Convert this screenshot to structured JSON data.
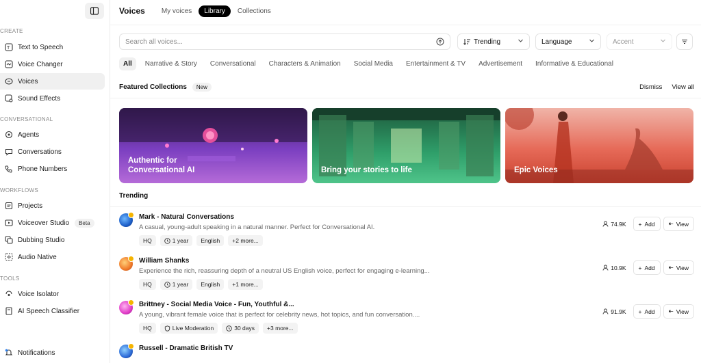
{
  "sidebar": {
    "sections": {
      "create": "CREATE",
      "conversational": "CONVERSATIONAL",
      "workflows": "WORKFLOWS",
      "tools": "TOOLS"
    },
    "items": {
      "text_to_speech": "Text to Speech",
      "voice_changer": "Voice Changer",
      "voices": "Voices",
      "sound_effects": "Sound Effects",
      "agents": "Agents",
      "conversations": "Conversations",
      "phone_numbers": "Phone Numbers",
      "projects": "Projects",
      "voiceover_studio": "Voiceover Studio",
      "dubbing_studio": "Dubbing Studio",
      "audio_native": "Audio Native",
      "voice_isolator": "Voice Isolator",
      "ai_speech_classifier": "AI Speech Classifier",
      "notifications": "Notifications"
    },
    "beta_badge": "Beta"
  },
  "header": {
    "title": "Voices",
    "tabs": [
      "My voices",
      "Library",
      "Collections"
    ],
    "active_tab": "Library"
  },
  "search": {
    "placeholder": "Search all voices...",
    "value": ""
  },
  "filters": {
    "sort": "Trending",
    "language": "Language",
    "accent": "Accent"
  },
  "categories": [
    "All",
    "Narrative & Story",
    "Conversational",
    "Characters & Animation",
    "Social Media",
    "Entertainment & TV",
    "Advertisement",
    "Informative & Educational"
  ],
  "featured": {
    "title": "Featured Collections",
    "badge": "New",
    "dismiss": "Dismiss",
    "view_all": "View all",
    "cards": [
      {
        "title": "Authentic for Conversational AI"
      },
      {
        "title": "Bring your stories to life"
      },
      {
        "title": "Epic Voices"
      }
    ]
  },
  "trending": {
    "title": "Trending",
    "add_label": "Add",
    "view_label": "View",
    "voices": [
      {
        "name": "Mark - Natural Conversations",
        "description": "A casual, young-adult speaking in a natural manner. Perfect for Conversational AI.",
        "tags": [
          "HQ",
          "1 year",
          "English",
          "+2 more..."
        ],
        "uses": "74.9K"
      },
      {
        "name": "William Shanks",
        "description": "Experience the rich, reassuring depth of a neutral US English voice, perfect for engaging e-learning...",
        "tags": [
          "HQ",
          "1 year",
          "English",
          "+1 more..."
        ],
        "uses": "10.9K"
      },
      {
        "name": "Brittney - Social Media Voice - Fun, Youthful &...",
        "description": "A young, vibrant female voice that is perfect for celebrity news, hot topics, and fun conversation....",
        "tags": [
          "HQ",
          "Live Moderation",
          "30 days",
          "+3 more..."
        ],
        "uses": "91.9K"
      },
      {
        "name": "Russell - Dramatic British TV",
        "description": "",
        "tags": [],
        "uses": ""
      }
    ]
  },
  "colors": {
    "accent": "#000000",
    "verified": "#f5b400",
    "card1": "#8e3fd1",
    "card2": "#2f9f6a",
    "card3": "#e0523f"
  }
}
